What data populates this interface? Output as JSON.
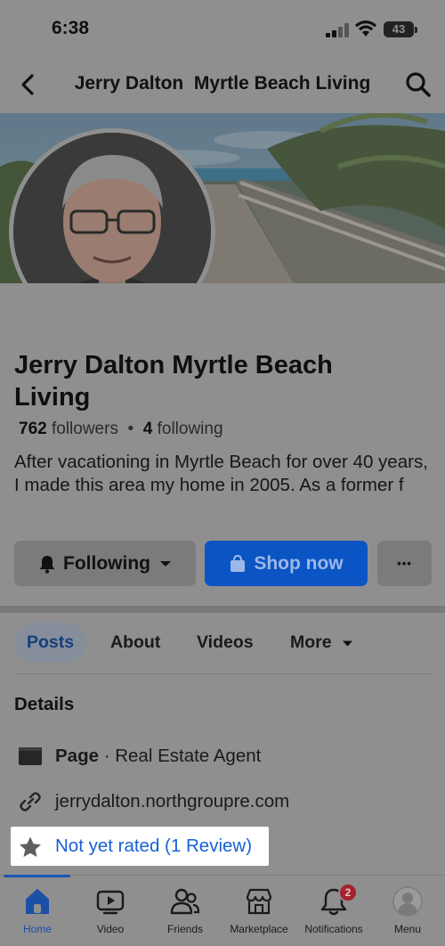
{
  "status_bar": {
    "time": "6:38",
    "battery": "43"
  },
  "header": {
    "title": "Jerry Dalton  Myrtle Beach Living"
  },
  "profile": {
    "name": "Jerry Dalton  Myrtle Beach Living",
    "followers_count": "762",
    "followers_label": "followers",
    "separator": "•",
    "following_count": "4",
    "following_label": "following",
    "bio": "After vacationing in Myrtle Beach for over 40 years, I made this area my home in 2005. As a former f"
  },
  "actions": {
    "following_label": "Following",
    "shop_label": "Shop now",
    "more_label": "•••"
  },
  "tabs": [
    {
      "label": "Posts"
    },
    {
      "label": "About"
    },
    {
      "label": "Videos"
    },
    {
      "label": "More"
    }
  ],
  "details": {
    "heading": "Details",
    "page_label": "Page",
    "page_category": " · Real Estate Agent",
    "website": "jerrydalton.northgroupre.com",
    "rating": "Not yet rated (1 Review)"
  },
  "bottom_nav": [
    {
      "label": "Home",
      "icon": "home-icon"
    },
    {
      "label": "Video",
      "icon": "video-icon"
    },
    {
      "label": "Friends",
      "icon": "friends-icon"
    },
    {
      "label": "Marketplace",
      "icon": "marketplace-icon"
    },
    {
      "label": "Notifications",
      "icon": "bell-icon",
      "badge": "2"
    },
    {
      "label": "Menu",
      "icon": "profile-menu-icon"
    }
  ],
  "colors": {
    "accent": "#0b54c4",
    "link": "#1760d6",
    "badge": "#a4222d"
  }
}
